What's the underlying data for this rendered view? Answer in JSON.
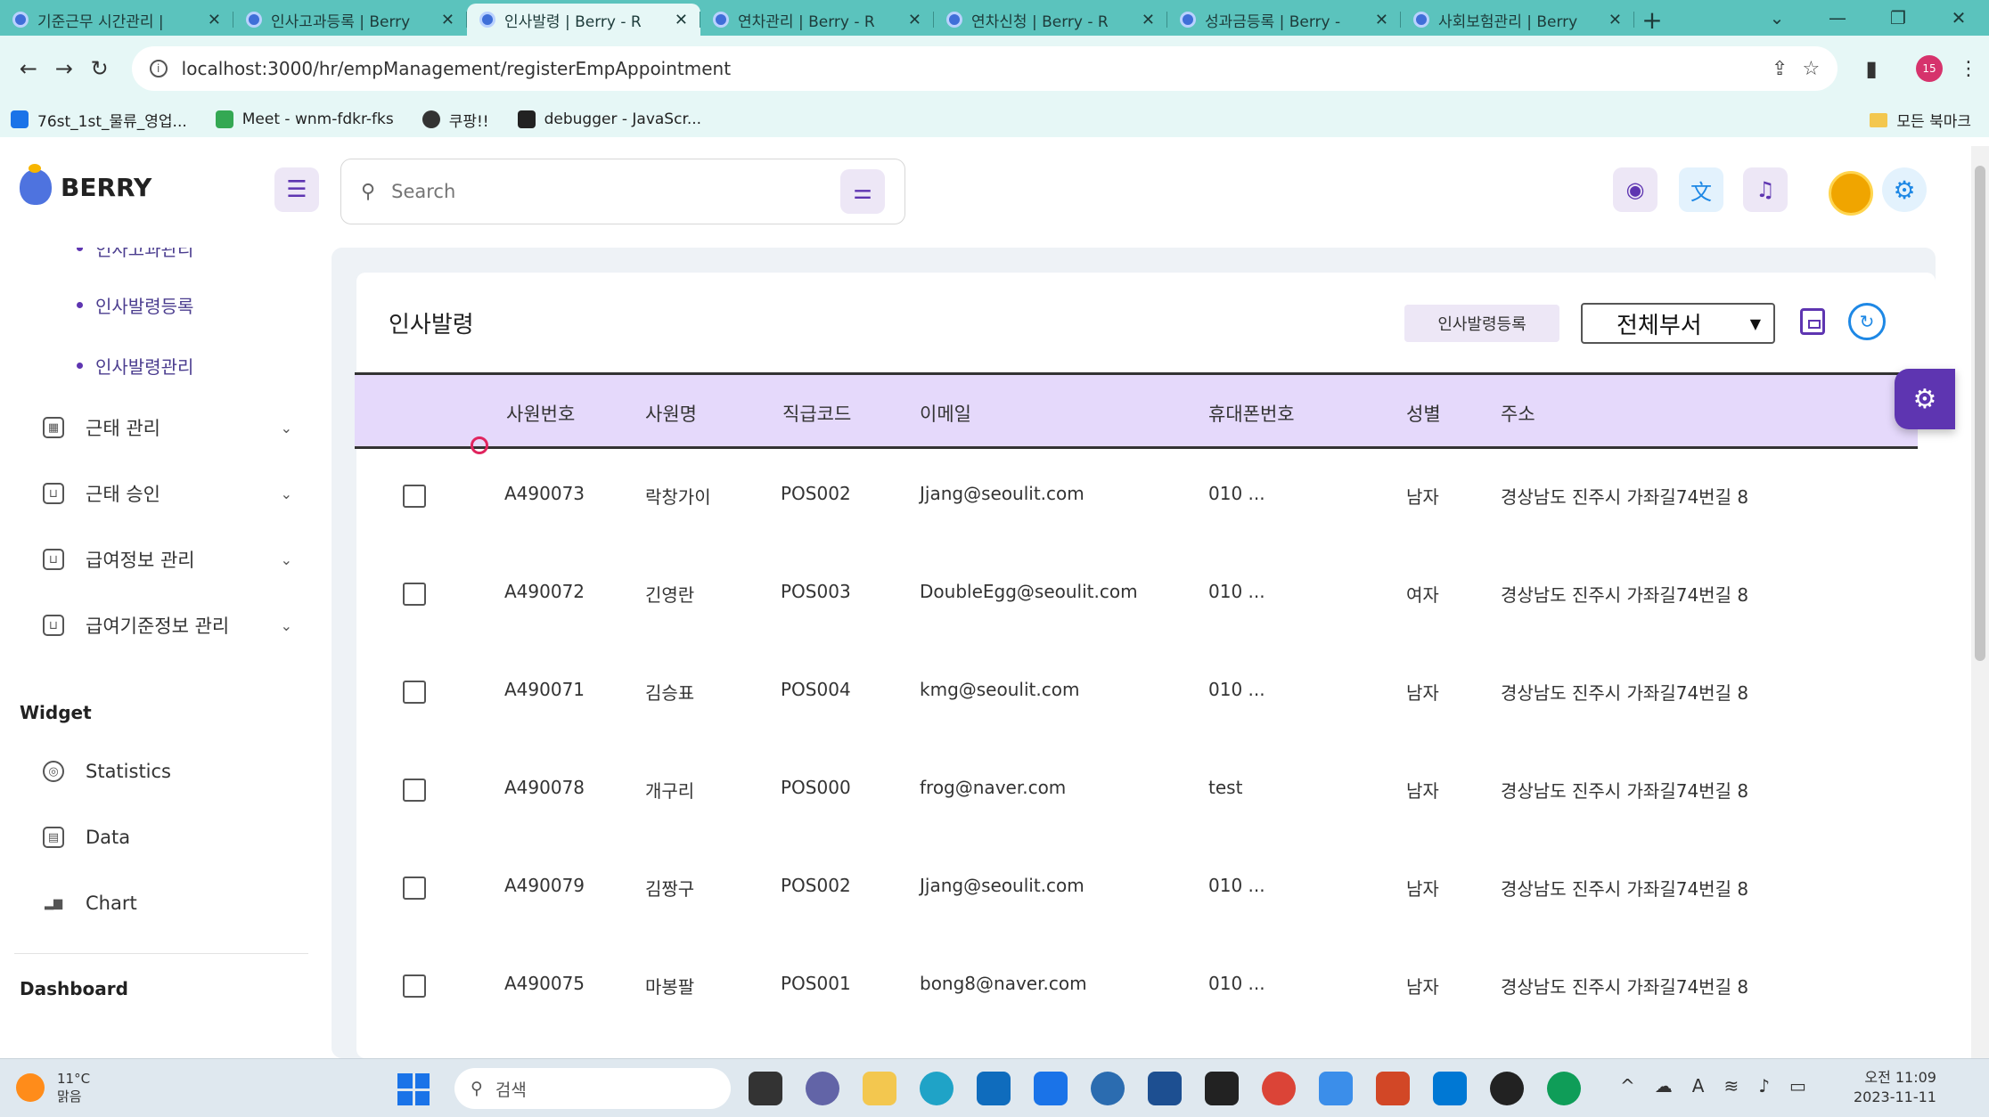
{
  "browser": {
    "tabs": [
      {
        "title": "기준근무 시간관리 |",
        "active": false
      },
      {
        "title": "인사고과등록 | Berry",
        "active": false
      },
      {
        "title": "인사발령 | Berry - R",
        "active": true
      },
      {
        "title": "연차관리 | Berry - R",
        "active": false
      },
      {
        "title": "연차신청 | Berry - R",
        "active": false
      },
      {
        "title": "성과금등록 | Berry -",
        "active": false
      },
      {
        "title": "사회보험관리 | Berry",
        "active": false
      }
    ],
    "url": "localhost:3000/hr/empManagement/registerEmpAppointment",
    "profile_initials": "15",
    "bookmarks": [
      "76st_1st_물류_영업...",
      "Meet - wnm-fdkr-fks",
      "쿠팡!!",
      "debugger - JavaScr..."
    ],
    "bookmark_folder": "모든 북마크"
  },
  "header": {
    "logo_text": "BERRY",
    "search_placeholder": "Search"
  },
  "sidebar": {
    "partial_item": "인사고과관리",
    "sub_items": [
      "인사발령등록",
      "인사발령관리"
    ],
    "items": [
      {
        "label": "근태 관리",
        "icon": "calendar-icon"
      },
      {
        "label": "근태 승인",
        "icon": "basket-icon"
      },
      {
        "label": "급여정보 관리",
        "icon": "basket-icon"
      },
      {
        "label": "급여기준정보 관리",
        "icon": "basket-icon"
      }
    ],
    "widget_title": "Widget",
    "widget_items": [
      "Statistics",
      "Data",
      "Chart"
    ],
    "dashboard_title": "Dashboard"
  },
  "main": {
    "title": "인사발령",
    "appointment_button": "인사발령등록",
    "department_select": "전체부서",
    "columns": [
      "사원번호",
      "사원명",
      "직급코드",
      "이메일",
      "휴대폰번호",
      "성별",
      "주소"
    ],
    "rows": [
      {
        "id": "A490073",
        "name": "락창가이",
        "pos": "POS002",
        "email": "Jjang@seoulit.com",
        "phone": "010 ...",
        "gender": "남자",
        "address": "경상남도 진주시 가좌길74번길 8"
      },
      {
        "id": "A490072",
        "name": "긴영란",
        "pos": "POS003",
        "email": "DoubleEgg@seoulit.com",
        "phone": "010 ...",
        "gender": "여자",
        "address": "경상남도 진주시 가좌길74번길 8"
      },
      {
        "id": "A490071",
        "name": "김승표",
        "pos": "POS004",
        "email": "kmg@seoulit.com",
        "phone": "010 ...",
        "gender": "남자",
        "address": "경상남도 진주시 가좌길74번길 8"
      },
      {
        "id": "A490078",
        "name": "개구리",
        "pos": "POS000",
        "email": "frog@naver.com",
        "phone": "test",
        "gender": "남자",
        "address": "경상남도 진주시 가좌길74번길 8"
      },
      {
        "id": "A490079",
        "name": "김짱구",
        "pos": "POS002",
        "email": "Jjang@seoulit.com",
        "phone": "010 ...",
        "gender": "남자",
        "address": "경상남도 진주시 가좌길74번길 8"
      },
      {
        "id": "A490075",
        "name": "마봉팔",
        "pos": "POS001",
        "email": "bong8@naver.com",
        "phone": "010 ...",
        "gender": "남자",
        "address": "경상남도 진주시 가좌길74번길 8"
      }
    ]
  },
  "taskbar": {
    "weather_temp": "11°C",
    "weather_desc": "맑음",
    "search_label": "검색",
    "time": "오전 11:09",
    "date": "2023-11-11"
  },
  "colors": {
    "tab_strip": "#5bc3bd",
    "accent": "#5e35b1",
    "table_header": "#e5d9fb"
  }
}
